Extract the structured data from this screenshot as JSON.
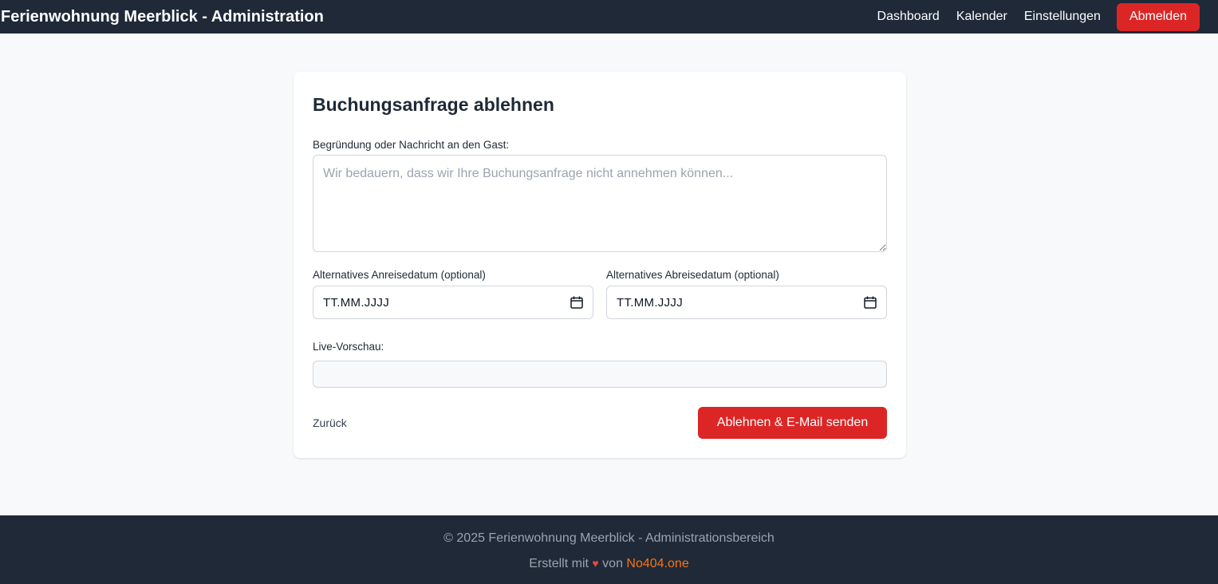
{
  "header": {
    "title": "Ferienwohnung Meerblick - Administration",
    "nav": [
      "Dashboard",
      "Kalender",
      "Einstellungen"
    ],
    "logout_label": "Abmelden"
  },
  "form": {
    "title": "Buchungsanfrage ablehnen",
    "reason_label": "Begründung oder Nachricht an den Gast:",
    "reason_placeholder": "Wir bedauern, dass wir Ihre Buchungsanfrage nicht annehmen können...",
    "reason_value": "",
    "arrival_label": "Alternatives Anreisedatum (optional)",
    "arrival_value": "TT.MM.JJJJ",
    "departure_label": "Alternatives Abreisedatum (optional)",
    "departure_value": "TT.MM.JJJJ",
    "preview_label": "Live-Vorschau:",
    "preview_value": "",
    "back_label": "Zurück",
    "submit_label": "Ablehnen & E-Mail senden"
  },
  "footer": {
    "copyright": "© 2025 Ferienwohnung Meerblick - Administrationsbereich",
    "made_with": "Erstellt mit",
    "by": "von",
    "author": "No404.one"
  },
  "icons": {
    "calendar": "calendar-icon",
    "heart": "heart-icon"
  },
  "colors": {
    "header_bg": "#1f2937",
    "danger": "#dc2626",
    "accent": "#f97316"
  }
}
